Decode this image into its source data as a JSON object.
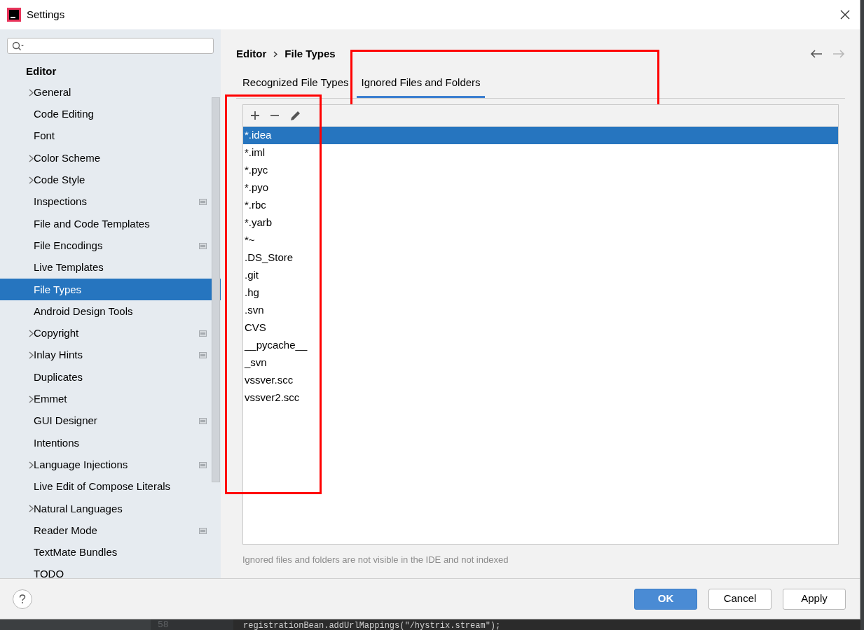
{
  "window": {
    "title": "Settings"
  },
  "sidebar": {
    "section": "Editor",
    "items": [
      {
        "label": "General",
        "expandable": true,
        "project_icon": false,
        "selected": false
      },
      {
        "label": "Code Editing",
        "expandable": false,
        "project_icon": false,
        "selected": false
      },
      {
        "label": "Font",
        "expandable": false,
        "project_icon": false,
        "selected": false
      },
      {
        "label": "Color Scheme",
        "expandable": true,
        "project_icon": false,
        "selected": false
      },
      {
        "label": "Code Style",
        "expandable": true,
        "project_icon": false,
        "selected": false
      },
      {
        "label": "Inspections",
        "expandable": false,
        "project_icon": true,
        "selected": false
      },
      {
        "label": "File and Code Templates",
        "expandable": false,
        "project_icon": false,
        "selected": false
      },
      {
        "label": "File Encodings",
        "expandable": false,
        "project_icon": true,
        "selected": false
      },
      {
        "label": "Live Templates",
        "expandable": false,
        "project_icon": false,
        "selected": false
      },
      {
        "label": "File Types",
        "expandable": false,
        "project_icon": false,
        "selected": true
      },
      {
        "label": "Android Design Tools",
        "expandable": false,
        "project_icon": false,
        "selected": false
      },
      {
        "label": "Copyright",
        "expandable": true,
        "project_icon": true,
        "selected": false
      },
      {
        "label": "Inlay Hints",
        "expandable": true,
        "project_icon": true,
        "selected": false
      },
      {
        "label": "Duplicates",
        "expandable": false,
        "project_icon": false,
        "selected": false
      },
      {
        "label": "Emmet",
        "expandable": true,
        "project_icon": false,
        "selected": false
      },
      {
        "label": "GUI Designer",
        "expandable": false,
        "project_icon": true,
        "selected": false
      },
      {
        "label": "Intentions",
        "expandable": false,
        "project_icon": false,
        "selected": false
      },
      {
        "label": "Language Injections",
        "expandable": true,
        "project_icon": true,
        "selected": false
      },
      {
        "label": "Live Edit of Compose Literals",
        "expandable": false,
        "project_icon": false,
        "selected": false
      },
      {
        "label": "Natural Languages",
        "expandable": true,
        "project_icon": false,
        "selected": false
      },
      {
        "label": "Reader Mode",
        "expandable": false,
        "project_icon": true,
        "selected": false
      },
      {
        "label": "TextMate Bundles",
        "expandable": false,
        "project_icon": false,
        "selected": false
      },
      {
        "label": "TODO",
        "expandable": false,
        "project_icon": false,
        "selected": false
      }
    ]
  },
  "breadcrumb": [
    "Editor",
    "File Types"
  ],
  "tabs": [
    {
      "label": "Recognized File Types",
      "selected": false,
      "highlighted": false
    },
    {
      "label": "Ignored Files and Folders",
      "selected": true,
      "highlighted": true
    }
  ],
  "ignored_list": {
    "highlighted": true,
    "items": [
      {
        "label": "*.idea",
        "selected": true
      },
      {
        "label": "*.iml",
        "selected": false
      },
      {
        "label": "*.pyc",
        "selected": false
      },
      {
        "label": "*.pyo",
        "selected": false
      },
      {
        "label": "*.rbc",
        "selected": false
      },
      {
        "label": "*.yarb",
        "selected": false
      },
      {
        "label": "*~",
        "selected": false
      },
      {
        "label": ".DS_Store",
        "selected": false
      },
      {
        "label": ".git",
        "selected": false
      },
      {
        "label": ".hg",
        "selected": false
      },
      {
        "label": ".svn",
        "selected": false
      },
      {
        "label": "CVS",
        "selected": false
      },
      {
        "label": "__pycache__",
        "selected": false
      },
      {
        "label": "_svn",
        "selected": false
      },
      {
        "label": "vssver.scc",
        "selected": false
      },
      {
        "label": "vssver2.scc",
        "selected": false
      }
    ]
  },
  "note": "Ignored files and folders are not visible in the IDE and not indexed",
  "buttons": [
    {
      "label": "OK",
      "kind": "default"
    },
    {
      "label": "Cancel",
      "kind": "normal"
    },
    {
      "label": "Apply",
      "kind": "normal"
    }
  ],
  "background_editor": {
    "line_number": "58",
    "code": "registrationBean.addUrlMappings(\"/hystrix.stream\");"
  }
}
